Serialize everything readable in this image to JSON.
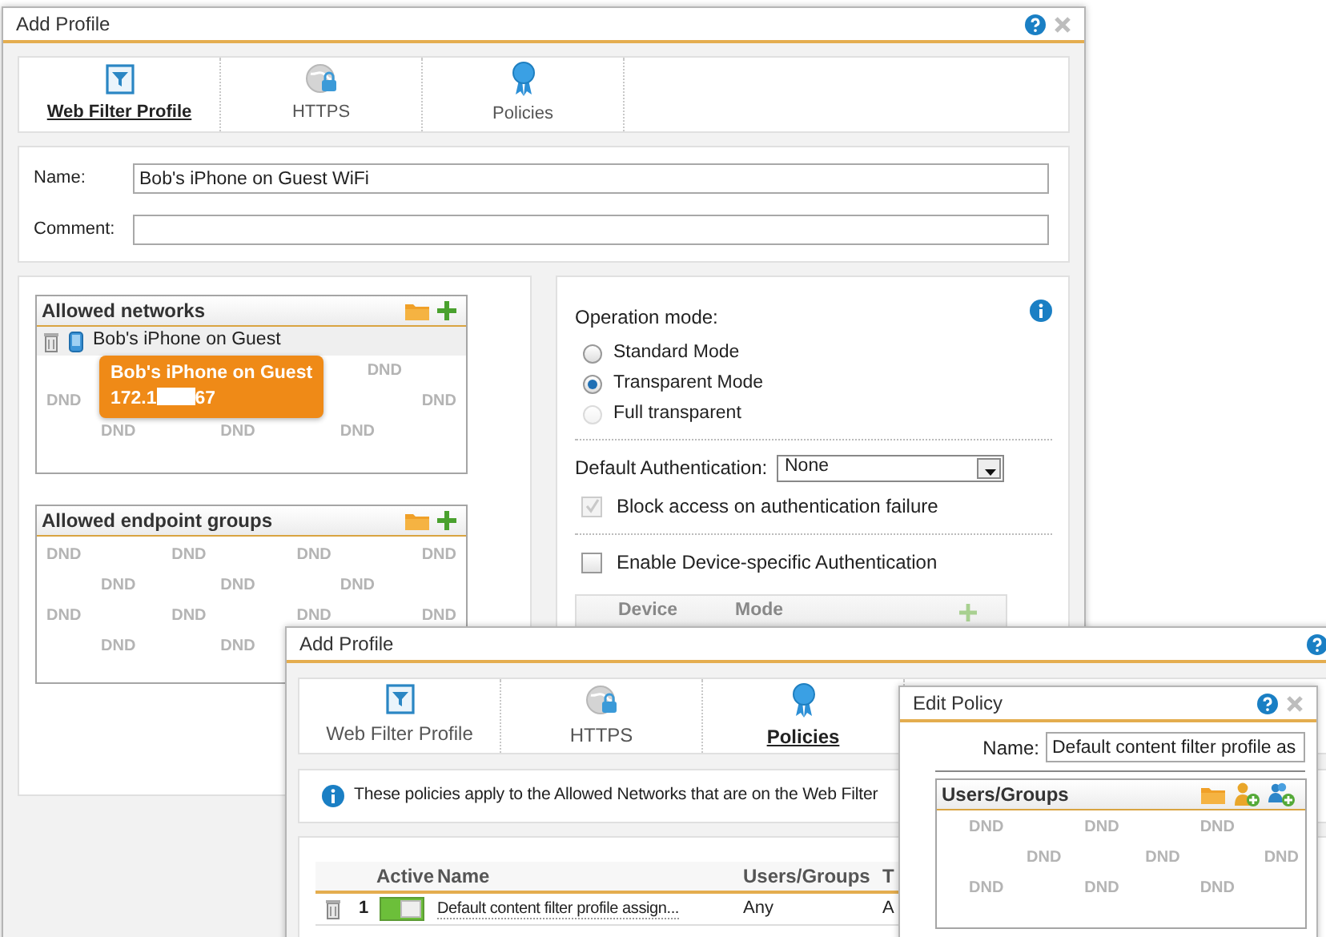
{
  "profile_window": {
    "title": "Add Profile",
    "closable": true,
    "tabs": [
      {
        "label": "Web Filter Profile",
        "kind": "filter",
        "selected": true
      },
      {
        "label": "HTTPS",
        "kind": "https",
        "selected": false
      },
      {
        "label": "Policies",
        "kind": "policies",
        "selected": false
      }
    ],
    "name": {
      "label": "Name:",
      "value": "Bob's iPhone on Guest WiFi"
    },
    "comment": {
      "label": "Comment:"
    },
    "allowed_networks": {
      "title": "Allowed networks",
      "items": [
        {
          "label": "Bob's iPhone on Guest"
        }
      ],
      "hint_rows": [
        {
          "kind": "trailing",
          "marks": [
            "DND"
          ]
        },
        {
          "kind": "full",
          "marks": [
            "DND",
            "DND"
          ]
        },
        {
          "kind": "inset",
          "marks": [
            "DND",
            "DND",
            "DND"
          ]
        }
      ]
    },
    "tooltip": {
      "title": "Bob's iPhone on Guest",
      "ip_parts": [
        "172.1",
        "67"
      ]
    },
    "allowed_endpoint_groups": {
      "title": "Allowed endpoint groups",
      "hint_rows": [
        {
          "kind": "full",
          "marks": [
            "DND",
            "DND",
            "DND",
            "DND"
          ]
        },
        {
          "kind": "inset",
          "marks": [
            "DND",
            "DND",
            "DND"
          ]
        },
        {
          "kind": "full",
          "marks": [
            "DND",
            "DND",
            "DND",
            "DND"
          ]
        },
        {
          "kind": "inset",
          "marks": [
            "DND",
            "DND"
          ]
        }
      ]
    },
    "operation_mode": {
      "label": "Operation mode:",
      "options": [
        {
          "label": "Standard Mode",
          "selected": false,
          "disabled": false
        },
        {
          "label": "Transparent Mode",
          "selected": true,
          "disabled": false
        },
        {
          "label": "Full transparent",
          "selected": false,
          "disabled": true
        }
      ]
    },
    "default_authentication": {
      "label": "Default Authentication:",
      "value": "None"
    },
    "checkboxes": [
      {
        "label": "Block access on authentication failure",
        "checked": true,
        "disabled": true
      },
      {
        "label": "Enable Device-specific Authentication",
        "checked": false,
        "disabled": false
      }
    ],
    "device_table": {
      "columns": [
        "Device",
        "Mode"
      ]
    }
  },
  "policies_window": {
    "title": "Add Profile",
    "closable": false,
    "tabs": [
      {
        "label": "Web Filter Profile",
        "kind": "filter",
        "selected": false
      },
      {
        "label": "HTTPS",
        "kind": "https",
        "selected": false
      },
      {
        "label": "Policies",
        "kind": "policies",
        "selected": true
      }
    ],
    "info": "These policies apply to the Allowed Networks that are on the Web Filter",
    "table": {
      "columns": [
        "Active",
        "Name",
        "Users/Groups",
        "T"
      ],
      "rows": [
        {
          "number": "1",
          "active": true,
          "name": "Default content filter profile assign...",
          "users_groups": "Any",
          "column_4": "A"
        }
      ]
    }
  },
  "edit_policy_window": {
    "title": "Edit Policy",
    "closable": true,
    "name": {
      "label": "Name:",
      "value": "Default content filter profile as"
    },
    "users_groups": {
      "title": "Users/Groups",
      "hint_rows": [
        {
          "kind": "full",
          "marks": [
            "DND",
            "DND",
            "DND"
          ]
        },
        {
          "kind": "inset",
          "marks": [
            "DND",
            "DND",
            "DND"
          ]
        },
        {
          "kind": "full",
          "marks": [
            "DND",
            "DND",
            "DND"
          ]
        }
      ]
    }
  }
}
